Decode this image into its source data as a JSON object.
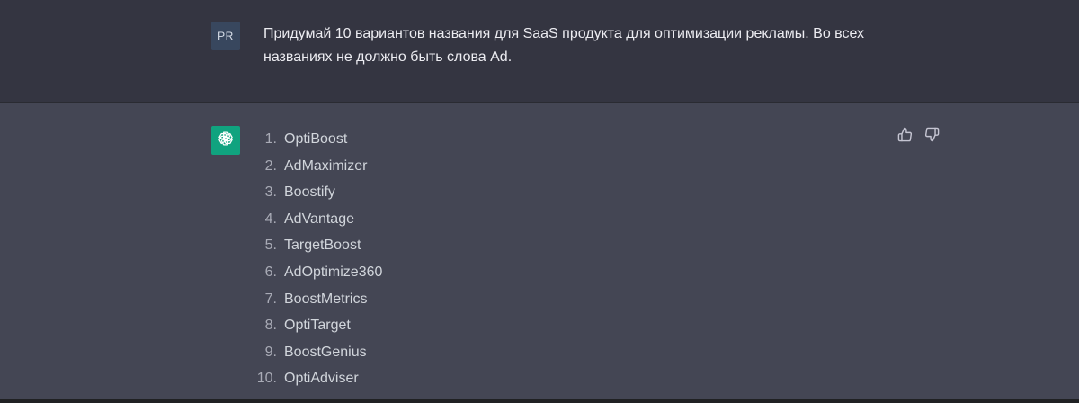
{
  "user_message": {
    "avatar_initials": "PR",
    "text": "Придумай 10 вариантов названия для SaaS продукта для оптимизации рекламы. Во всех названиях не должно быть слова Ad."
  },
  "assistant_message": {
    "avatar_icon": "openai-logo-icon",
    "items": [
      {
        "number": "1.",
        "text": "OptiBoost"
      },
      {
        "number": "2.",
        "text": "AdMaximizer"
      },
      {
        "number": "3.",
        "text": "Boostify"
      },
      {
        "number": "4.",
        "text": "AdVantage"
      },
      {
        "number": "5.",
        "text": "TargetBoost"
      },
      {
        "number": "6.",
        "text": "AdOptimize360"
      },
      {
        "number": "7.",
        "text": "BoostMetrics"
      },
      {
        "number": "8.",
        "text": "OptiTarget"
      },
      {
        "number": "9.",
        "text": "BoostGenius"
      },
      {
        "number": "10.",
        "text": "OptiAdviser"
      }
    ],
    "feedback": {
      "up_icon": "thumbs-up-icon",
      "down_icon": "thumbs-down-icon"
    }
  },
  "colors": {
    "user_bg": "#343541",
    "assistant_bg": "#444654",
    "avatar_user_bg": "#38475e",
    "avatar_bot_bg": "#10a37f",
    "text": "#ececf1"
  }
}
